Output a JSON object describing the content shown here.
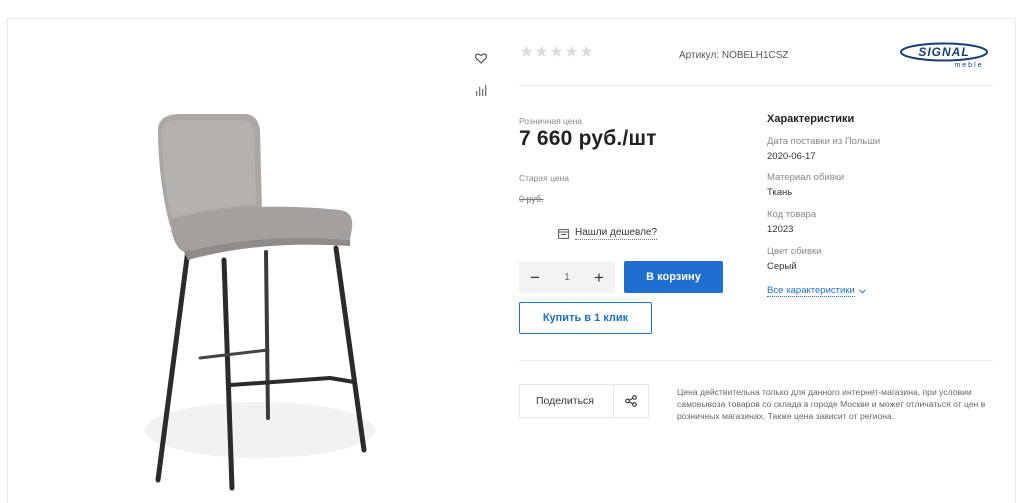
{
  "rating": {
    "stars": 5,
    "filled": 0
  },
  "article": {
    "label": "Артикул:",
    "value": "NOBELH1CSZ"
  },
  "brand": {
    "name": "SIGNAL",
    "sub": "meble"
  },
  "price": {
    "label": "Розничная цена",
    "value": "7 660 руб./шт",
    "old_label": "Старая цена",
    "old_value": "0 руб."
  },
  "cheaper_link": "Нашли дешевле?",
  "quantity": {
    "minus": "−",
    "value": "1",
    "plus": "+"
  },
  "buttons": {
    "cart": "В корзину",
    "one_click": "Купить в 1 клик",
    "share": "Поделиться"
  },
  "characteristics": {
    "title": "Характеристики",
    "items": [
      {
        "name": "Дата поставки из Польши",
        "value": "2020-06-17"
      },
      {
        "name": "Материал обивки",
        "value": "Ткань"
      },
      {
        "name": "Код товара",
        "value": "12023"
      },
      {
        "name": "Цвет обивки",
        "value": "Серый"
      }
    ],
    "all_link": "Все характеристики"
  },
  "note": "Цена действительна только для данного интернет-магазина, при условии самовывоза товаров со склада в городе Москве и может отличаться от цен в розничных магазинах. Также цена зависит от региона.",
  "colors": {
    "accent": "#1f6fd1",
    "star": "#dddddd",
    "upholstery": "#a9a6a4",
    "frame": "#2b2b2b"
  },
  "icons": [
    "heart-icon",
    "compare-chart-icon",
    "star-icon",
    "calendar-icon",
    "chevron-down-icon",
    "share-icon"
  ]
}
